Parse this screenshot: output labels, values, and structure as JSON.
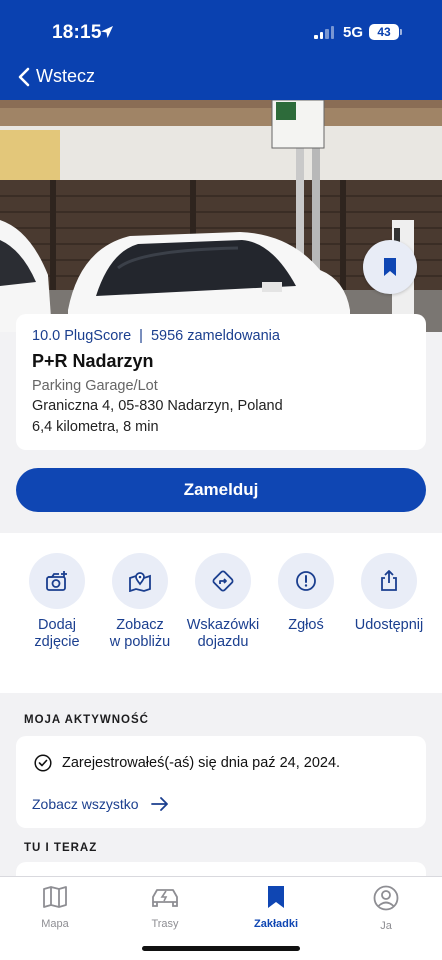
{
  "status_bar": {
    "time": "18:15",
    "network": "5G",
    "battery": "43"
  },
  "nav": {
    "back_label": "Wstecz"
  },
  "station": {
    "plugscore": "10.0 PlugScore",
    "separator": "|",
    "checkins": "5956 zameldowania",
    "name": "P+R Nadarzyn",
    "type": "Parking Garage/Lot",
    "address": "Graniczna 4, 05-830 Nadarzyn, Poland",
    "distance": "6,4 kilometra, 8 min"
  },
  "checkin_button": "Zamelduj",
  "actions": [
    {
      "line1": "Dodaj",
      "line2": "zdjęcie",
      "icon": "add-photo-icon"
    },
    {
      "line1": "Zobacz",
      "line2": "w pobliżu",
      "icon": "map-pin-icon"
    },
    {
      "line1": "Wskazówki",
      "line2": "dojazdu",
      "icon": "directions-icon"
    },
    {
      "line1": "Zgłoś",
      "line2": "",
      "icon": "report-icon"
    },
    {
      "line1": "Udostępnij",
      "line2": "",
      "icon": "share-icon"
    }
  ],
  "activity": {
    "title": "MOJA AKTYWNOŚĆ",
    "entry": "Zarejestrowałeś(-aś) się dnia paź 24, 2024.",
    "see_all": "Zobacz wszystko"
  },
  "here_now": {
    "title": "TU I TERAZ"
  },
  "tabs": [
    {
      "label": "Mapa",
      "icon": "map-icon",
      "active": false
    },
    {
      "label": "Trasy",
      "icon": "car-icon",
      "active": false
    },
    {
      "label": "Zakładki",
      "icon": "bookmark-icon",
      "active": true
    },
    {
      "label": "Ja",
      "icon": "profile-icon",
      "active": false
    }
  ],
  "colors": {
    "primary": "#0a41b0",
    "link": "#1b3f8f",
    "action_circle": "#e9edf7"
  }
}
